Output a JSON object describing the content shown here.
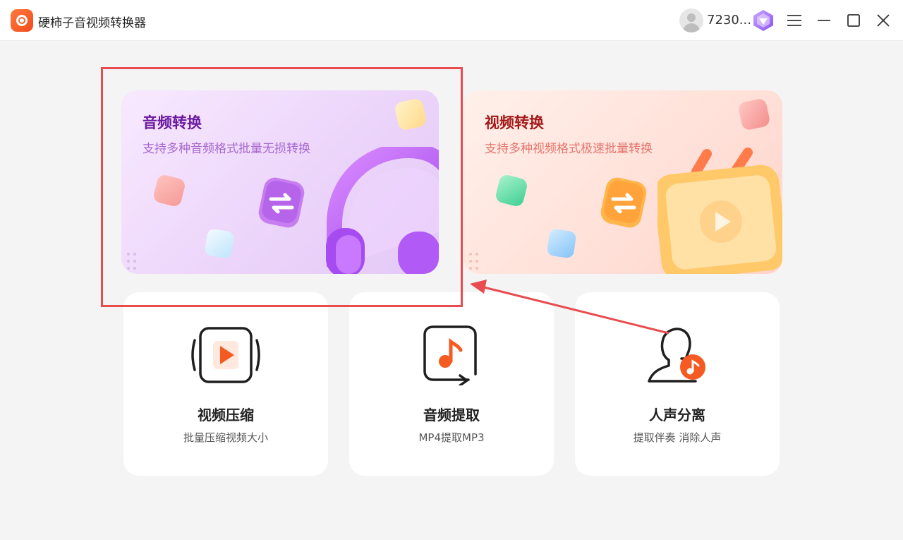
{
  "window": {
    "title": "硬柿子音视频转换器",
    "user_name": "7230..."
  },
  "cards": {
    "audio": {
      "title": "音频转换",
      "subtitle": "支持多种音频格式批量无损转换"
    },
    "video": {
      "title": "视频转换",
      "subtitle": "支持多种视频格式极速批量转换"
    }
  },
  "tools": [
    {
      "title": "视频压缩",
      "subtitle": "批量压缩视频大小",
      "icon": "video-compress-icon"
    },
    {
      "title": "音频提取",
      "subtitle": "MP4提取MP3",
      "icon": "audio-extract-icon"
    },
    {
      "title": "人声分离",
      "subtitle": "提取伴奏 消除人声",
      "icon": "vocal-separation-icon"
    }
  ],
  "colors": {
    "accent_orange": "#f45a22",
    "annotation_red": "#e84c4f",
    "audio_card_title": "#6b1a9e",
    "video_card_title": "#a31a1a"
  }
}
